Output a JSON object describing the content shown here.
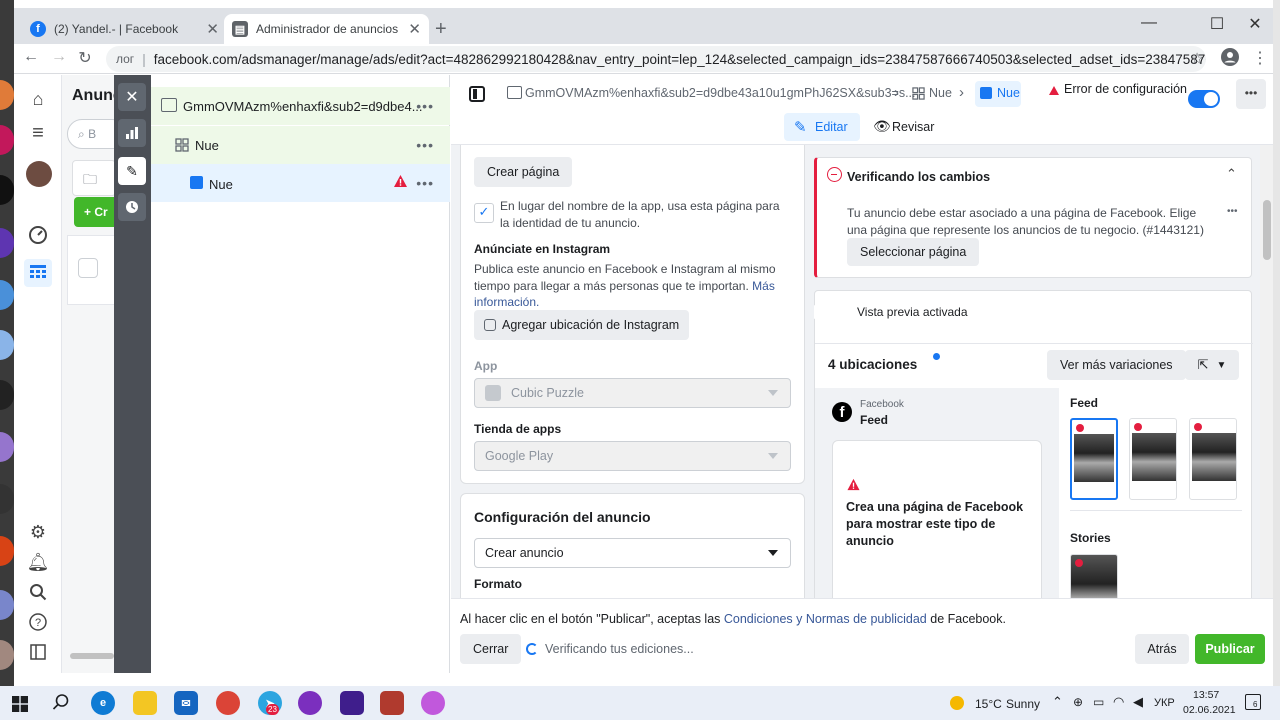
{
  "browser": {
    "tabs": [
      {
        "title": "(2) Yandel.- | Facebook",
        "icon": "facebook-icon"
      },
      {
        "title": "Administrador de anuncios - Adm",
        "icon": "ads-manager-icon"
      }
    ],
    "url_prefix": "лог",
    "url": "facebook.com/adsmanager/manage/ads/edit?act=482862992180428&nav_entry_point=lep_124&selected_campaign_ids=23847587666740503&selected_adset_ids=23847587666770503&selected..."
  },
  "listpanel": {
    "title": "Anunc",
    "search_placeholder": "B",
    "create_label": "+ Cr"
  },
  "tree": {
    "campaign": "GmmOVMAzm%enhaxfi&sub2=d9dbe4...",
    "adset": "Nue",
    "ad": "Nue"
  },
  "topbar": {
    "breadcrumb_campaign": "GmmOVMAzm%enhaxfi&sub2=d9dbe43a10u1gmPhJ62SX&sub3=s...",
    "breadcrumb_adset": "Nue",
    "breadcrumb_ad": "Nue",
    "error_label": "Error de configuración"
  },
  "modes": {
    "edit": "Editar",
    "review": "Revisar"
  },
  "identity": {
    "create_page_button": "Crear página",
    "use_page_text": "En lugar del nombre de la app, usa esta página para la identidad de tu anuncio.",
    "instagram_heading": "Anúnciate en Instagram",
    "instagram_text": "Publica este anuncio en Facebook e Instagram al mismo tiempo para llegar a más personas que te importan.",
    "more_info_link": "Más información.",
    "add_instagram_button": "Agregar ubicación de Instagram",
    "app_label": "App",
    "app_value": "Cubic Puzzle",
    "store_label": "Tienda de apps",
    "store_value": "Google Play"
  },
  "ad_config": {
    "heading": "Configuración del anuncio",
    "create_value": "Crear anuncio",
    "format_label": "Formato"
  },
  "verify": {
    "title": "Verificando los cambios",
    "message": "Tu anuncio debe estar asociado a una página de Facebook. Elige una página que represente los anuncios de tu negocio. (#1443121)",
    "select_button": "Seleccionar página"
  },
  "preview": {
    "toggle_label": "Vista previa activada",
    "placements_title": "4 ubicaciones",
    "more_variations_button": "Ver más variaciones",
    "platform": "Facebook",
    "position": "Feed",
    "warning_text": "Crea una página de Facebook para mostrar este tipo de anuncio",
    "feed_label": "Feed",
    "stories_label": "Stories"
  },
  "footer": {
    "terms_prefix": "Al hacer clic en el botón \"Publicar\", aceptas las ",
    "terms_link": "Condiciones y Normas de publicidad",
    "terms_suffix": " de Facebook.",
    "close_button": "Cerrar",
    "status": "Verificando tus ediciones...",
    "back_button": "Atrás",
    "publish_button": "Publicar"
  },
  "taskbar": {
    "weather_temp": "15°C",
    "weather_text": "Sunny",
    "language": "УКР",
    "time": "13:57",
    "date": "02.06.2021",
    "notifications": "6",
    "telegram_badge": "23"
  },
  "colors": {
    "fb_blue": "#1877f2",
    "publish_green": "#42b72a",
    "error_red": "#e41e3f",
    "dark_strip": "#4b4f56"
  }
}
